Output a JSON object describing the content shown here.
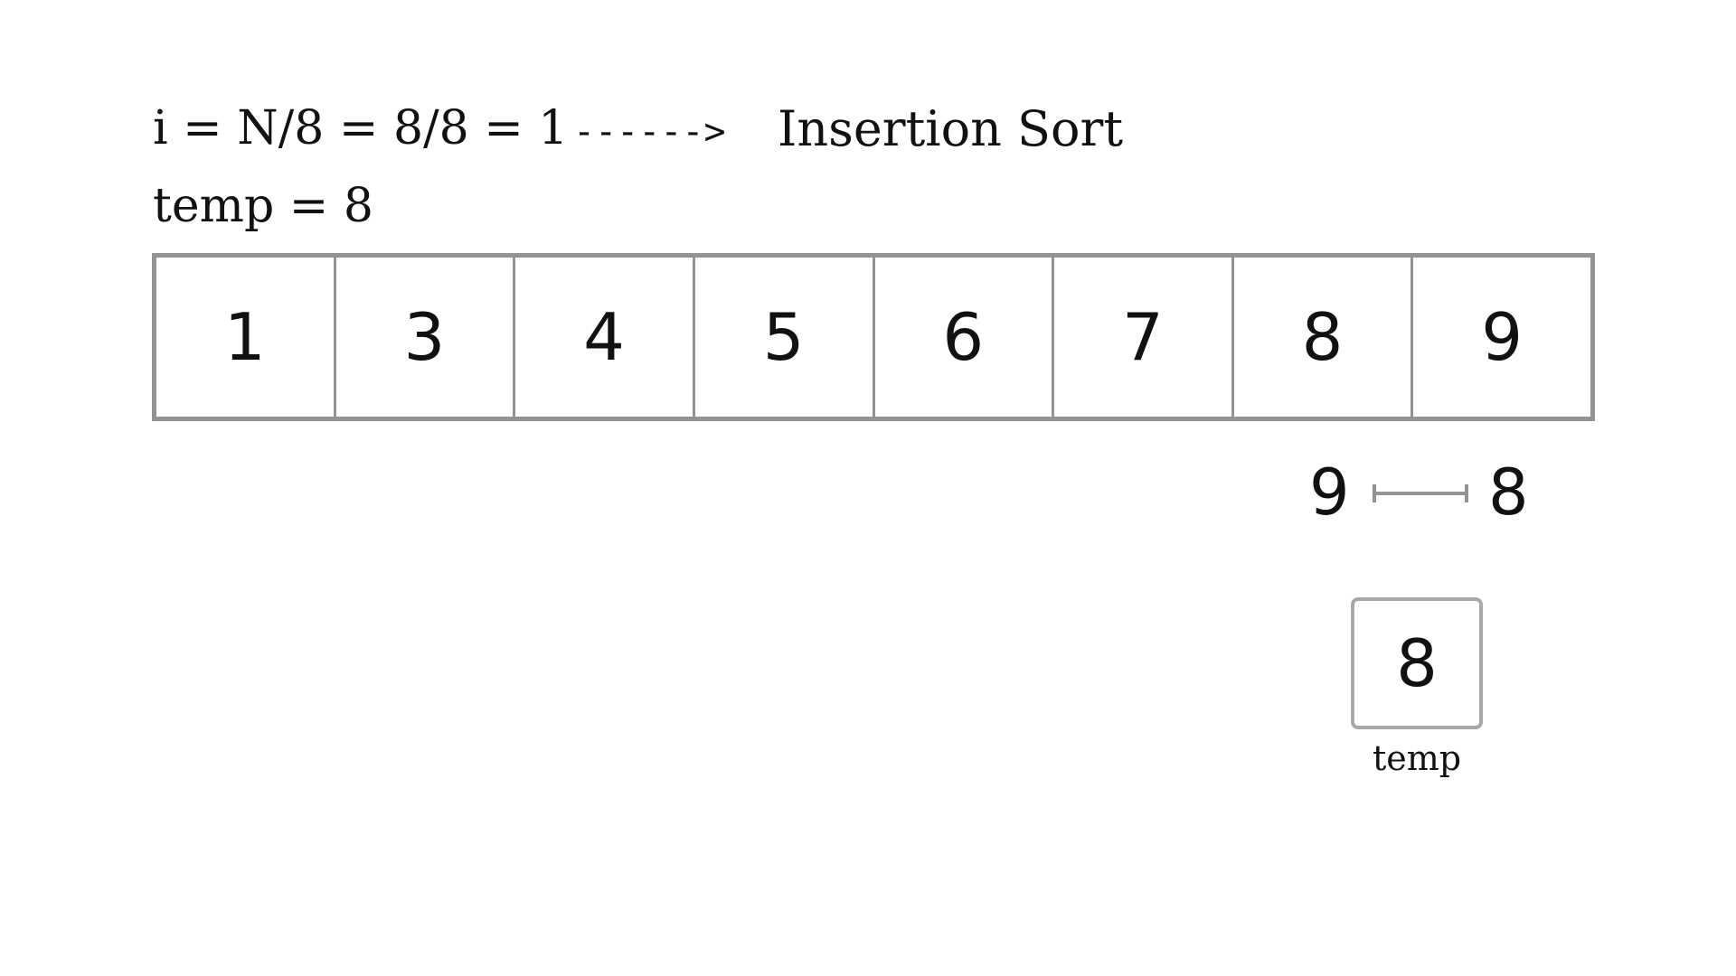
{
  "header": {
    "formula": "i = N/8 = 8/8 = 1",
    "arrow": "------>",
    "algorithm": "Insertion Sort",
    "temp_assignment": "temp = 8"
  },
  "array": {
    "cells": [
      "1",
      "3",
      "4",
      "5",
      "6",
      "7",
      "8",
      "9"
    ]
  },
  "swap": {
    "left_value": "9",
    "right_value": "8"
  },
  "temp_box": {
    "value": "8",
    "caption": "temp"
  },
  "colors": {
    "border": "#939393",
    "temp_border": "#a8a8a8",
    "text": "#111111",
    "background": "#ffffff"
  },
  "icons": {
    "swap_connector": "horizontal-bar-connector-icon"
  }
}
